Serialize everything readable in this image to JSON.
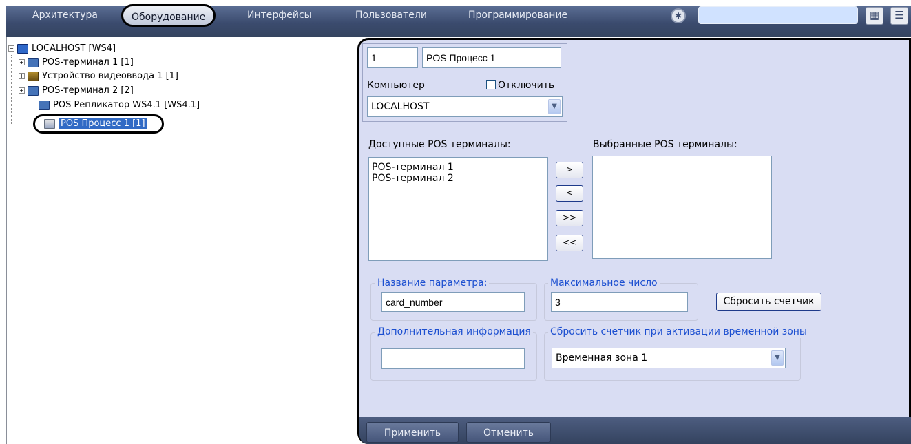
{
  "menu": {
    "items": [
      {
        "label": "Архитектура",
        "active": false
      },
      {
        "label": "Оборудование",
        "active": true
      },
      {
        "label": "Интерфейсы",
        "active": false
      },
      {
        "label": "Пользователи",
        "active": false
      },
      {
        "label": "Программирование",
        "active": false
      }
    ],
    "search_value": ""
  },
  "icons": {
    "circle": "settings-circle-icon",
    "grid": "grid-view-icon",
    "list": "menu-list-icon"
  },
  "tree": {
    "root": "LOCALHOST [WS4]",
    "children": [
      {
        "label": "POS-терминал 1 [1]",
        "icon": "pos-terminal-icon",
        "expandable": true
      },
      {
        "label": "Устройство видеоввода 1 [1]",
        "icon": "video-input-icon",
        "expandable": true
      },
      {
        "label": "POS-терминал 2 [2]",
        "icon": "pos-terminal-icon",
        "expandable": true
      },
      {
        "label": "POS Репликатор WS4.1 [WS4.1]",
        "icon": "pos-replicator-icon",
        "expandable": false
      },
      {
        "label": "POS Процесс 1 [1]",
        "icon": "pos-process-icon",
        "expandable": false,
        "selected": true
      }
    ]
  },
  "form": {
    "id_value": "1",
    "name_value": "POS Процесс 1",
    "computer_label": "Компьютер",
    "disable_label": "Отключить",
    "disable_checked": false,
    "computer_value": "LOCALHOST",
    "available_label": "Доступные POS терминалы:",
    "selected_label": "Выбранные POS терминалы:",
    "available_items": [
      "POS-терминал 1",
      "POS-терминал 2"
    ],
    "selected_items": [],
    "move_buttons": {
      "add": ">",
      "remove": "<",
      "add_all": ">>",
      "remove_all": "<<"
    },
    "param_name_label": "Название параметра:",
    "param_name_value": "card_number",
    "max_number_label": "Максимальное число",
    "max_number_value": "3",
    "reset_button": "Сбросить счетчик",
    "extra_info_label": "Дополнительная информация",
    "extra_info_value": "",
    "reset_on_tz_label": "Сбросить счетчик при активации временной зоны",
    "time_zone_value": "Временная зона 1"
  },
  "buttons": {
    "apply": "Применить",
    "cancel": "Отменить"
  },
  "colors": {
    "menu_bar": "#3b4b6e",
    "panel_bg": "#d9ddf3",
    "label_blue": "#1c4fd0",
    "selection": "#316ac5"
  }
}
